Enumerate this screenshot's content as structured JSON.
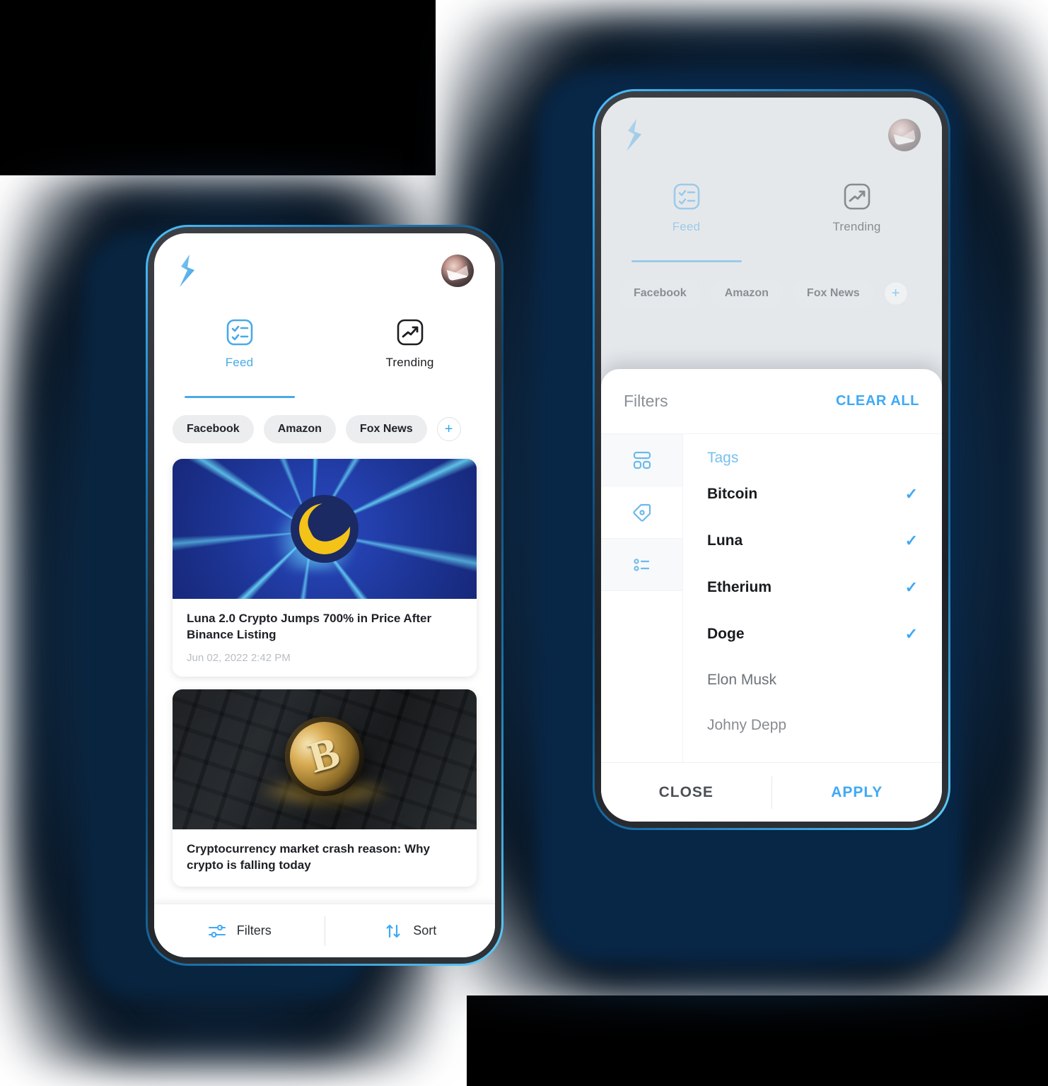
{
  "app": {
    "logo_icon": "lightning-bolt-logo",
    "avatar_icon": "user-avatar",
    "accent_color": "#3fa9f5",
    "tabs": [
      {
        "label": "Feed",
        "icon": "checklist-icon",
        "active": true
      },
      {
        "label": "Trending",
        "icon": "trending-up-icon",
        "active": false
      }
    ],
    "chips": [
      {
        "label": "Facebook"
      },
      {
        "label": "Amazon"
      },
      {
        "label": "Fox News"
      }
    ],
    "chip_add_label": "+",
    "articles": [
      {
        "title": "Luna 2.0 Crypto Jumps 700% in Price After Binance Listing",
        "date": "Jun 02, 2022 2:42 PM",
        "image_alt": "cracked-glass-luna-coin"
      },
      {
        "title": "Cryptocurrency market crash reason: Why crypto is falling today",
        "date": "",
        "image_alt": "bitcoin-coin-on-keyboard"
      }
    ],
    "bottom_bar": [
      {
        "label": "Filters",
        "icon": "filters-sliders-icon"
      },
      {
        "label": "Sort",
        "icon": "sort-arrows-icon"
      }
    ]
  },
  "filter_sheet": {
    "title": "Filters",
    "clear_all_label": "CLEAR ALL",
    "rail": [
      {
        "icon": "layout-grid-icon",
        "selected": true
      },
      {
        "icon": "tag-icon",
        "selected": false
      },
      {
        "icon": "list-options-icon",
        "selected": false
      }
    ],
    "section_label": "Tags",
    "tags": [
      {
        "label": "Bitcoin",
        "checked": true
      },
      {
        "label": "Luna",
        "checked": true
      },
      {
        "label": "Etherium",
        "checked": true
      },
      {
        "label": "Doge",
        "checked": true
      },
      {
        "label": "Elon Musk",
        "checked": false
      },
      {
        "label": "Johny Depp",
        "checked": false
      }
    ],
    "close_label": "CLOSE",
    "apply_label": "APPLY"
  }
}
